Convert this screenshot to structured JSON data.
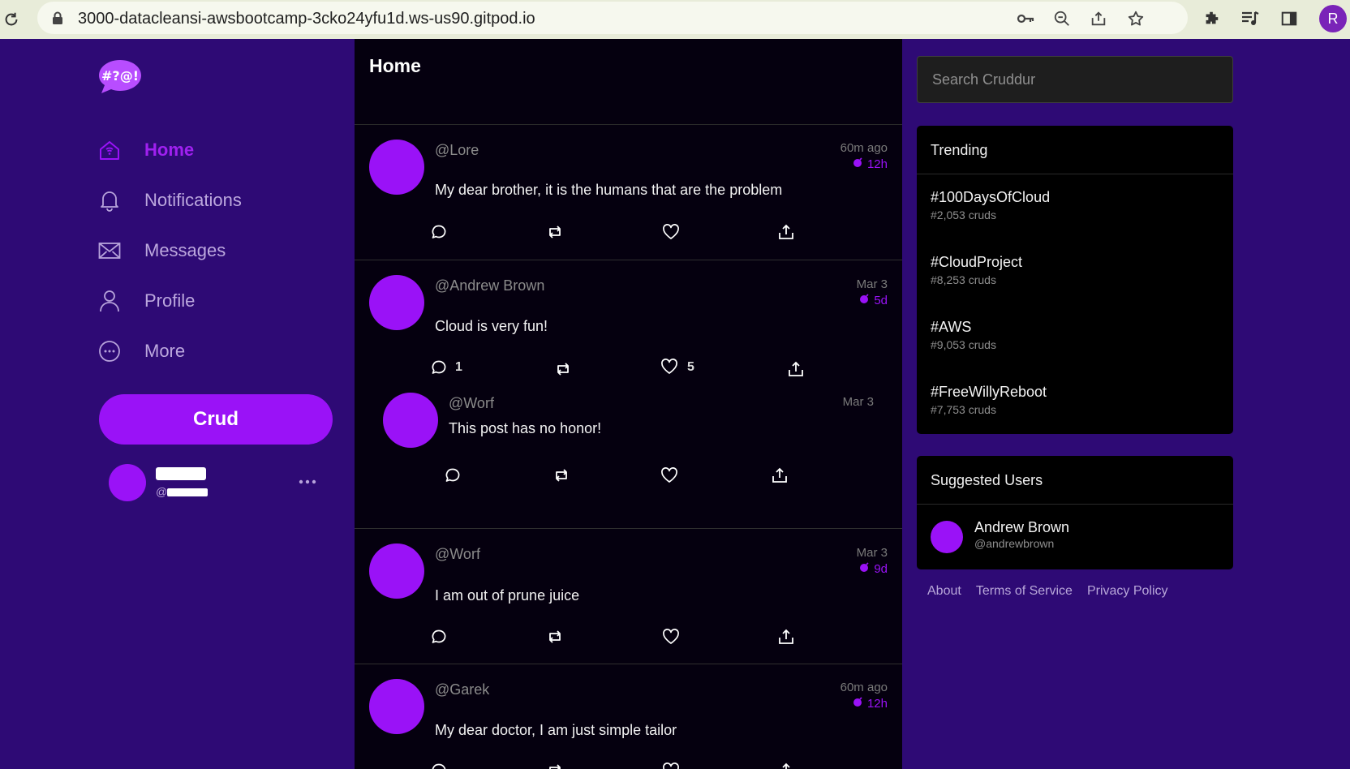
{
  "browser": {
    "url": "3000-datacleansi-awsbootcamp-3cko24yfu1d.ws-us90.gitpod.io",
    "profile_initial": "R"
  },
  "nav": {
    "items": [
      {
        "label": "Home",
        "icon": "home-icon",
        "active": true
      },
      {
        "label": "Notifications",
        "icon": "bell-icon",
        "active": false
      },
      {
        "label": "Messages",
        "icon": "envelope-icon",
        "active": false
      },
      {
        "label": "Profile",
        "icon": "user-icon",
        "active": false
      },
      {
        "label": "More",
        "icon": "more-circle-icon",
        "active": false
      }
    ],
    "crud_label": "Crud",
    "user": {
      "handle_prefix": "@"
    }
  },
  "feed": {
    "title": "Home",
    "posts": [
      {
        "handle": "@Lore",
        "time": "60m ago",
        "expires": "12h",
        "message": "My dear brother, it is the humans that are the problem",
        "replies": "",
        "likes": ""
      },
      {
        "handle": "@Andrew Brown",
        "time": "Mar 3",
        "expires": "5d",
        "message": "Cloud is very fun!",
        "replies": "1",
        "likes": "5",
        "reply": {
          "handle": "@Worf",
          "time": "Mar 3",
          "message": "This post has no honor!"
        }
      },
      {
        "handle": "@Worf",
        "time": "Mar 3",
        "expires": "9d",
        "message": "I am out of prune juice",
        "replies": "",
        "likes": ""
      },
      {
        "handle": "@Garek",
        "time": "60m ago",
        "expires": "12h",
        "message": "My dear doctor, I am just simple tailor",
        "replies": "",
        "likes": ""
      }
    ]
  },
  "search": {
    "placeholder": "Search Cruddur"
  },
  "trending": {
    "title": "Trending",
    "items": [
      {
        "tag": "#100DaysOfCloud",
        "count": "#2,053 cruds"
      },
      {
        "tag": "#CloudProject",
        "count": "#8,253 cruds"
      },
      {
        "tag": "#AWS",
        "count": "#9,053 cruds"
      },
      {
        "tag": "#FreeWillyReboot",
        "count": "#7,753 cruds"
      }
    ]
  },
  "suggested": {
    "title": "Suggested Users",
    "users": [
      {
        "name": "Andrew Brown",
        "handle": "@andrewbrown"
      }
    ]
  },
  "footer": {
    "links": [
      "About",
      "Terms of Service",
      "Privacy Policy"
    ]
  },
  "colors": {
    "accent": "#9a12f7",
    "background": "#2e0a75",
    "feed": "#05000f"
  }
}
